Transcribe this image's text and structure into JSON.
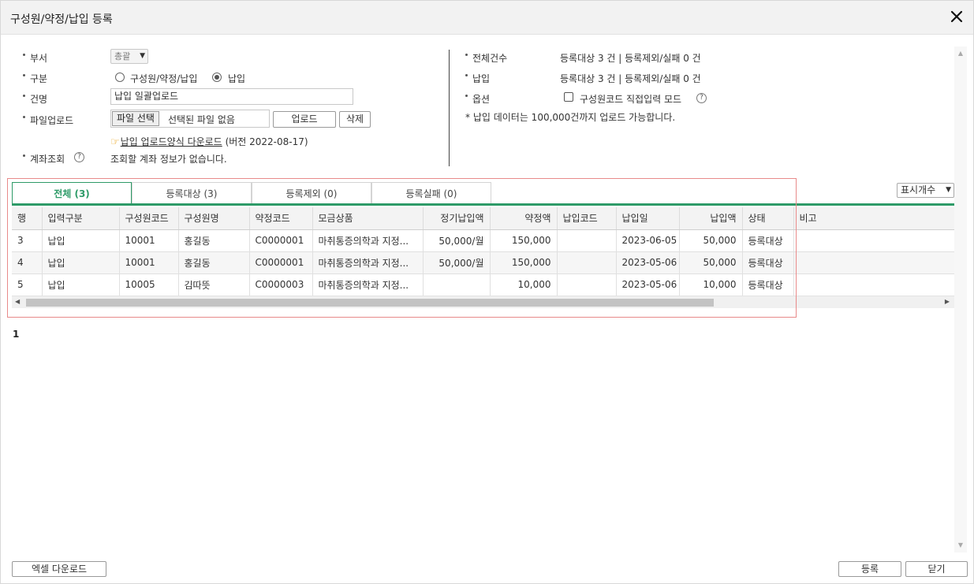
{
  "window": {
    "title": "구성원/약정/납입 등록"
  },
  "form": {
    "dept_label": "부서",
    "dept_value": "총괄",
    "type_label": "구분",
    "type_options": [
      "구성원/약정/납입",
      "납입"
    ],
    "type_selected": "납입",
    "name_label": "건명",
    "name_value": "납입 일괄업로드",
    "upload_label": "파일업로드",
    "file_pick_label": "파일 선택",
    "file_none_text": "선택된 파일 없음",
    "upload_button": "업로드",
    "delete_button": "삭제",
    "template_link": "납입 업로드양식 다운로드",
    "template_version": "(버전 2022-08-17)",
    "account_label": "계좌조회",
    "account_value": "조회할 계좌 정보가 없습니다."
  },
  "summary": {
    "total_label": "전체건수",
    "total_value": "등록대상 3 건 | 등록제외/실패 0 건",
    "payment_label": "납입",
    "payment_value": "등록대상 3 건 | 등록제외/실패 0 건",
    "option_label": "옵션",
    "option_checkbox_label": "구성원코드 직접입력 모드",
    "option_checked": false,
    "note": "* 납입 데이터는 100,000건까지 업로드 가능합니다."
  },
  "tabs": [
    {
      "label": "전체 (3)",
      "active": true
    },
    {
      "label": "등록대상 (3)",
      "active": false
    },
    {
      "label": "등록제외 (0)",
      "active": false
    },
    {
      "label": "등록실패 (0)",
      "active": false
    }
  ],
  "page_size_label": "표시개수",
  "grid": {
    "columns": [
      "행",
      "입력구분",
      "구성원코드",
      "구성원명",
      "약정코드",
      "모금상품",
      "정기납입액",
      "약정액",
      "납입코드",
      "납입일",
      "납입액",
      "상태",
      "비고"
    ],
    "rows": [
      [
        "3",
        "납입",
        "10001",
        "홍길동",
        "C0000001",
        "마취통증의학과 지정...",
        "50,000/월",
        "150,000",
        "",
        "2023-06-05",
        "50,000",
        "등록대상",
        ""
      ],
      [
        "4",
        "납입",
        "10001",
        "홍길동",
        "C0000001",
        "마취통증의학과 지정...",
        "50,000/월",
        "150,000",
        "",
        "2023-05-06",
        "50,000",
        "등록대상",
        ""
      ],
      [
        "5",
        "납입",
        "10005",
        "김따뜻",
        "C0000003",
        "마취통증의학과 지정...",
        "",
        "10,000",
        "",
        "2023-05-06",
        "10,000",
        "등록대상",
        ""
      ]
    ]
  },
  "pager": {
    "current": "1"
  },
  "footer": {
    "excel_button": "엑셀 다운로드",
    "register_button": "등록",
    "close_button": "닫기"
  },
  "icons": {
    "close": "close-icon",
    "help": "help-icon",
    "hand": "pointing-hand-icon"
  }
}
